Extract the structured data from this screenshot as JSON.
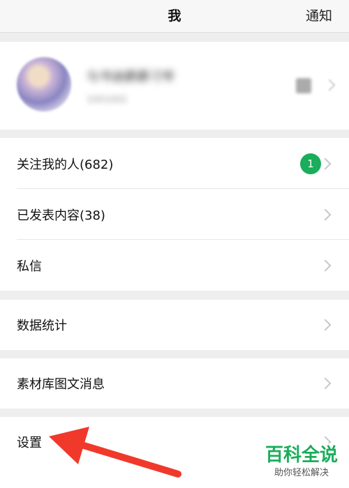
{
  "header": {
    "title": "我",
    "notify_label": "通知"
  },
  "profile": {
    "name": "与书迪爵爵刁爷",
    "sub": "1001002"
  },
  "menu_group1": [
    {
      "label": "关注我的人(682)",
      "badge": "1"
    },
    {
      "label": "已发表内容(38)"
    },
    {
      "label": "私信"
    }
  ],
  "menu_group2": [
    {
      "label": "数据统计"
    }
  ],
  "menu_group3": [
    {
      "label": "素材库图文消息"
    }
  ],
  "menu_group4": [
    {
      "label": "设置"
    }
  ],
  "watermark": {
    "main": "百科全说",
    "sub": "助你轻松解决"
  },
  "colors": {
    "badge": "#1aad5b",
    "arrow": "#f0392b",
    "background": "#eeeeee"
  }
}
